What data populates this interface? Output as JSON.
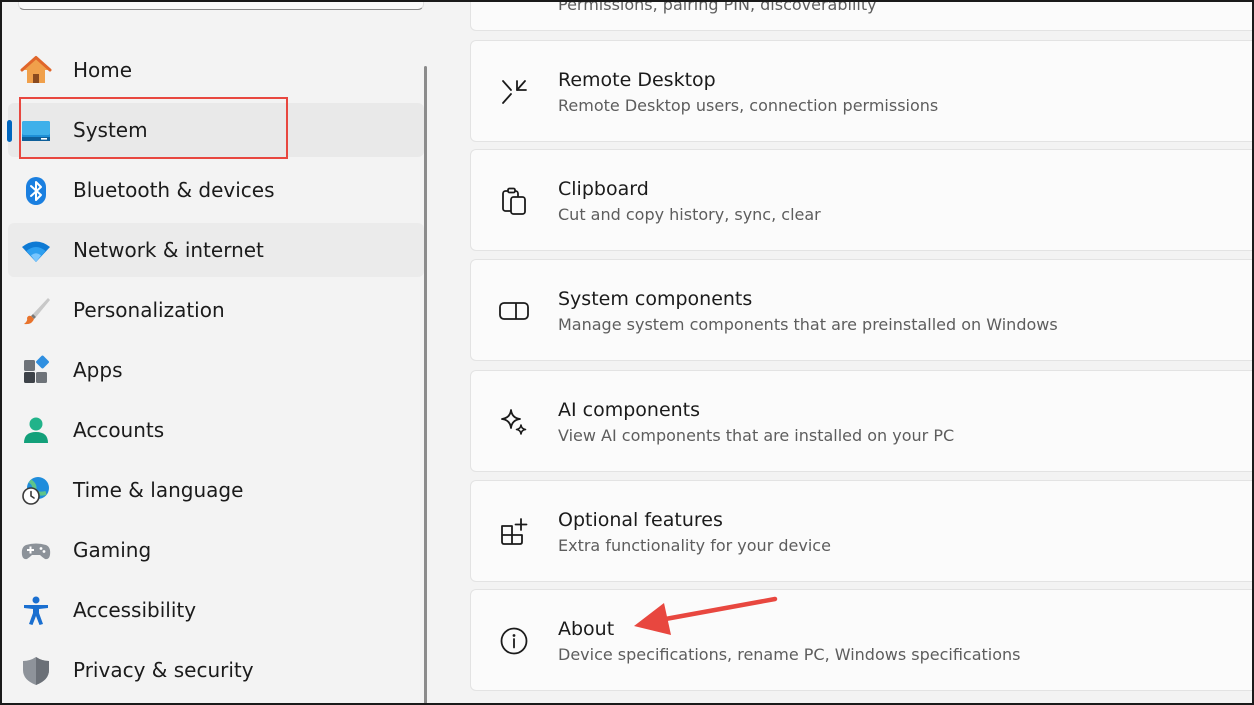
{
  "sidebar": {
    "items": [
      {
        "label": "Home",
        "icon": "home-icon"
      },
      {
        "label": "System",
        "icon": "system-monitor-icon",
        "selected": true
      },
      {
        "label": "Bluetooth & devices",
        "icon": "bluetooth-icon"
      },
      {
        "label": "Network & internet",
        "icon": "wifi-icon"
      },
      {
        "label": "Personalization",
        "icon": "paintbrush-icon"
      },
      {
        "label": "Apps",
        "icon": "apps-icon"
      },
      {
        "label": "Accounts",
        "icon": "account-person-icon"
      },
      {
        "label": "Time & language",
        "icon": "globe-clock-icon"
      },
      {
        "label": "Gaming",
        "icon": "gamepad-icon"
      },
      {
        "label": "Accessibility",
        "icon": "accessibility-icon"
      },
      {
        "label": "Privacy & security",
        "icon": "shield-icon"
      }
    ]
  },
  "main": {
    "cut_off_subtitle": "Permissions, pairing PIN, discoverability",
    "cards": [
      {
        "title": "Remote Desktop",
        "subtitle": "Remote Desktop users, connection permissions",
        "icon": "remote-desktop-icon"
      },
      {
        "title": "Clipboard",
        "subtitle": "Cut and copy history, sync, clear",
        "icon": "clipboard-icon"
      },
      {
        "title": "System components",
        "subtitle": "Manage system components that are preinstalled on Windows",
        "icon": "system-components-icon"
      },
      {
        "title": "AI components",
        "subtitle": "View AI components that are installed on your PC",
        "icon": "sparkle-icon"
      },
      {
        "title": "Optional features",
        "subtitle": "Extra functionality for your device",
        "icon": "optional-features-icon"
      },
      {
        "title": "About",
        "subtitle": "Device specifications, rename PC, Windows specifications",
        "icon": "info-icon"
      }
    ]
  },
  "colors": {
    "accent": "#0067c0",
    "annotation": "#e8473f"
  }
}
